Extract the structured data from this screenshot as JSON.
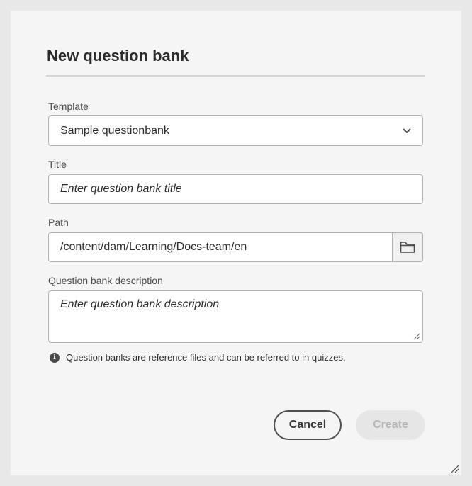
{
  "dialog": {
    "title": "New question bank",
    "template": {
      "label": "Template",
      "selected": "Sample questionbank",
      "icon": "chevron-down-icon"
    },
    "title_field": {
      "label": "Title",
      "placeholder": "Enter question bank title"
    },
    "path": {
      "label": "Path",
      "value": "/content/dam/Learning/Docs-team/en",
      "browse_icon": "folder-icon"
    },
    "description": {
      "label": "Question bank description",
      "placeholder": "Enter question bank description"
    },
    "info": {
      "icon": "info-icon",
      "text": "Question banks are reference files and can be referred to in quizzes."
    },
    "buttons": {
      "cancel": "Cancel",
      "create": "Create"
    }
  },
  "colors": {
    "background": "#e8e8e8",
    "dialog": "#f5f5f5",
    "field_border": "#b3b3b3",
    "disabled_button": "#e6e6e6"
  }
}
